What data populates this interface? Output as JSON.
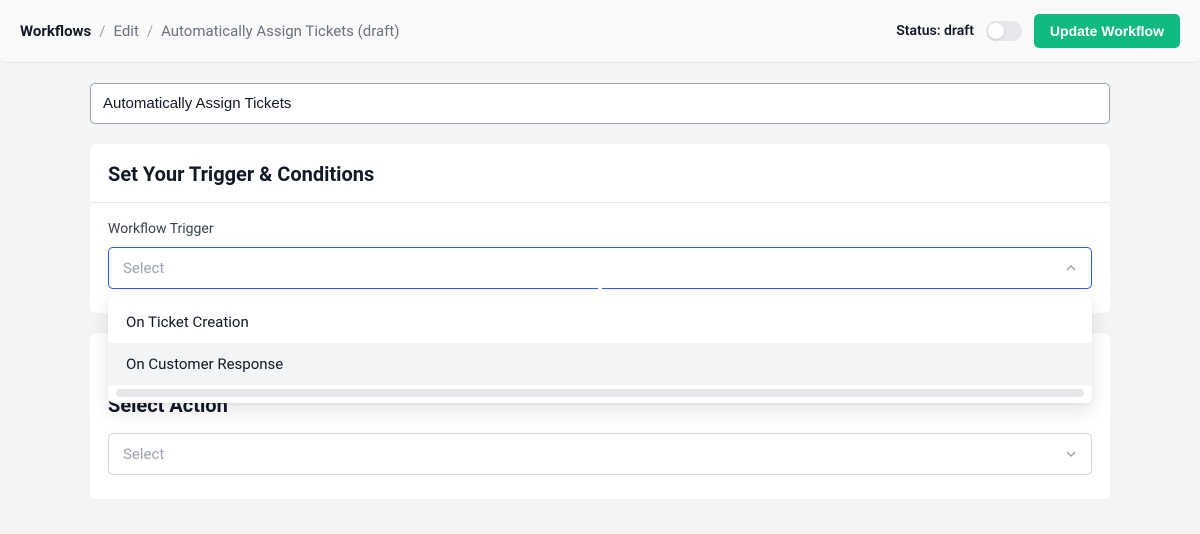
{
  "header": {
    "breadcrumb": {
      "root": "Workflows",
      "mid": "Edit",
      "current": "Automatically Assign Tickets (draft)"
    },
    "status_label": "Status: draft",
    "update_button": "Update Workflow"
  },
  "workflow_name": {
    "value": "Automatically Assign Tickets"
  },
  "trigger_card": {
    "title": "Set Your Trigger & Conditions",
    "field_label": "Workflow Trigger",
    "select_placeholder": "Select",
    "options": [
      "On Ticket Creation",
      "On Customer Response"
    ]
  },
  "action_card": {
    "title": "Select Action",
    "select_placeholder": "Select"
  }
}
